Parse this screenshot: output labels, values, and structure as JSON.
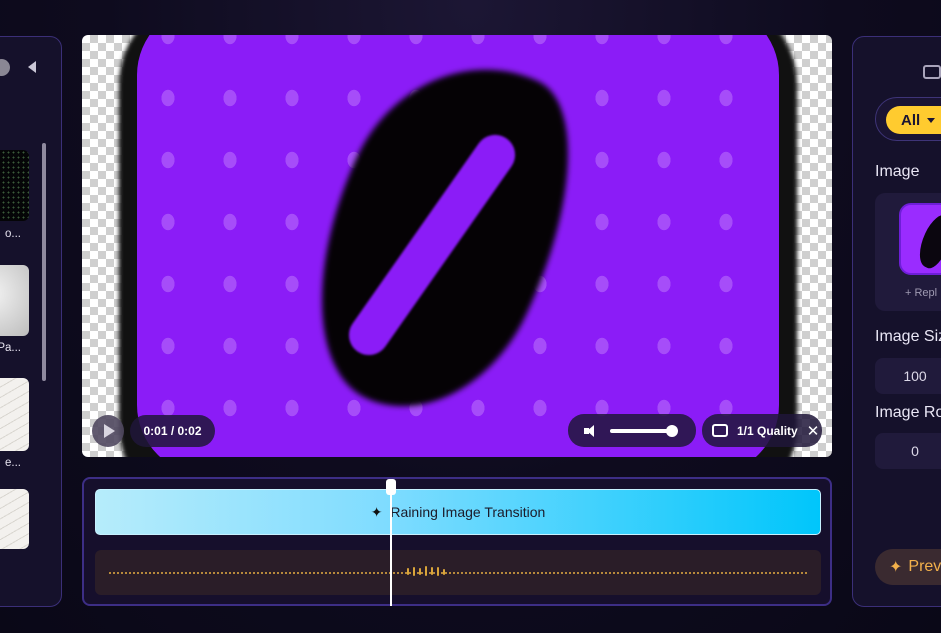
{
  "left_panel": {
    "collapse_icon": "chevron-left-icon",
    "templates": [
      {
        "label": "o..."
      },
      {
        "label": "Pa..."
      },
      {
        "label": "e..."
      },
      {
        "label": ""
      }
    ]
  },
  "player": {
    "time": "0:01 / 0:02",
    "quality_label": "1/1 Quality",
    "volume": 1.0,
    "play_icon": "play-icon",
    "volume_icon": "speaker-icon",
    "quality_icon": "quality-icon",
    "close_icon": "close-icon"
  },
  "timeline": {
    "clip_label": "Raining Image Transition",
    "clip_icon": "sparkle-icon"
  },
  "right_panel": {
    "filter_label": "All",
    "image_heading": "Image",
    "replace_label": "+ Repl",
    "image_size_heading": "Image Siz",
    "image_size_value": "100",
    "image_rotation_heading": "Image Ro",
    "image_rotation_value": "0",
    "preview_label": "Prev",
    "colors": {
      "accent": "#ffcb2f",
      "border": "#3b2f78"
    }
  }
}
